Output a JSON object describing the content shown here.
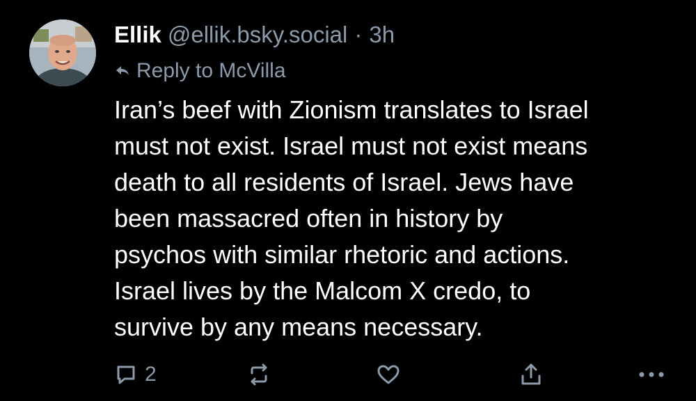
{
  "post": {
    "author": {
      "display_name": "Ellik",
      "handle": "@ellik.bsky.social",
      "separator": "·",
      "time": "3h"
    },
    "reply_to": "Reply to McVilla",
    "text_lines": [
      "Iran’s beef with Zionism translates to Israel",
      "must not exist. Israel must not exist means",
      "death to all residents of Israel. Jews have",
      "been massacred often in history by",
      "psychos with similar rhetoric and actions.",
      "Israel lives by the Malcom X credo, to",
      "survive by any means necessary."
    ],
    "actions": {
      "reply_count": "2",
      "icons": [
        "comment-icon",
        "repost-icon",
        "heart-icon",
        "share-icon",
        "more-icon"
      ]
    }
  },
  "colors": {
    "background": "#000000",
    "text": "#ffffff",
    "muted": "#8c9bab"
  }
}
